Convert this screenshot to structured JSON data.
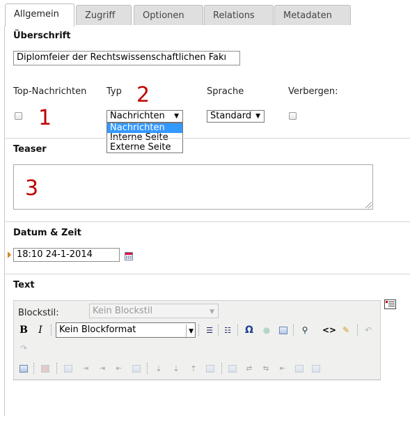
{
  "tabs": [
    {
      "label": "Allgemein",
      "active": true
    },
    {
      "label": "Zugriff",
      "active": false
    },
    {
      "label": "Optionen",
      "active": false
    },
    {
      "label": "Relations",
      "active": false
    },
    {
      "label": "Metadaten",
      "active": false
    }
  ],
  "heading": {
    "label": "Überschrift",
    "value": "Diplomfeier der Rechtswissenschaftlichen Fakı"
  },
  "fields": {
    "top_news_label": "Top-Nachrichten",
    "type_label": "Typ",
    "language_label": "Sprache",
    "hide_label": "Verbergen:",
    "type_value": "Nachrichten",
    "type_options": [
      "Nachrichten",
      "Interne Seite",
      "Externe Seite"
    ],
    "language_value": "Standard"
  },
  "annotations": {
    "one": "1",
    "two": "2",
    "three": "3"
  },
  "teaser": {
    "label": "Teaser",
    "value": ""
  },
  "datetime": {
    "label": "Datum & Zeit",
    "value": "18:10 24-1-2014"
  },
  "text": {
    "label": "Text",
    "blockstyle_label": "Blockstil:",
    "blockstyle_value": "Kein Blockstil",
    "blockformat_value": "Kein Blockformat"
  },
  "colors": {
    "annotation": "#c00000",
    "selected_option": "#3399ff"
  }
}
